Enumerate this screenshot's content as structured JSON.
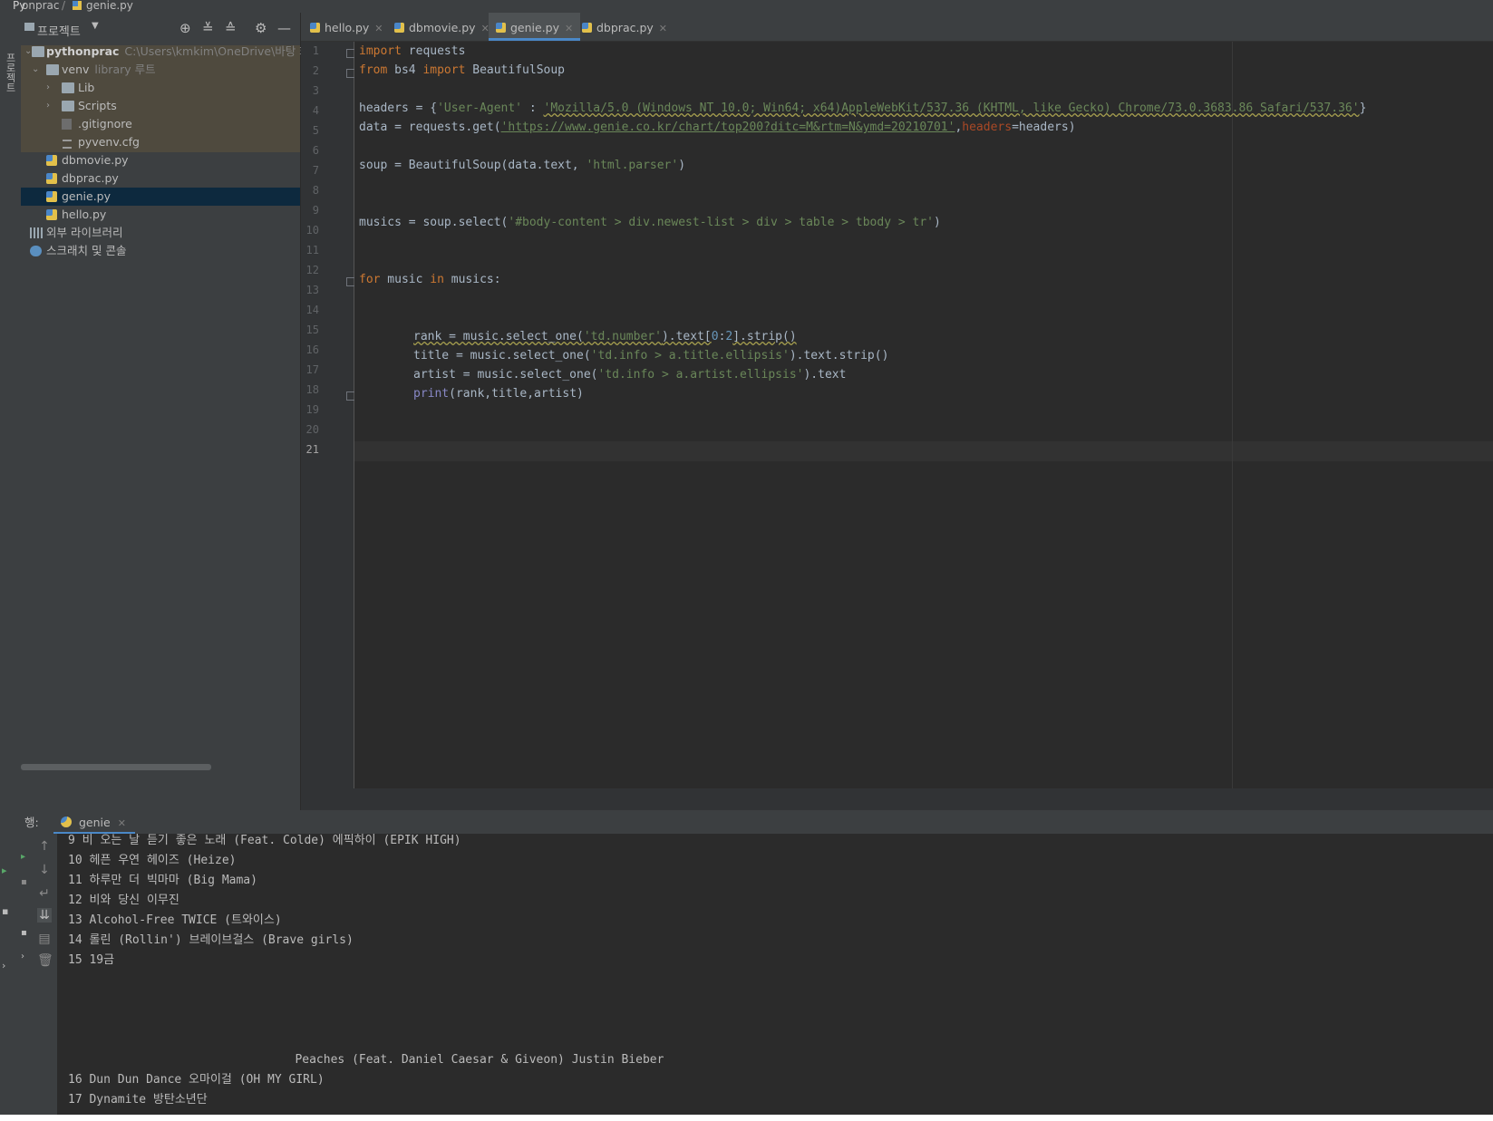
{
  "top_bar": {
    "project": "onprac",
    "separator": "/",
    "file": "genie.py",
    "left_icon": "Py"
  },
  "left_strip": {
    "vertical_tab": "프로젝트"
  },
  "project_panel": {
    "title": "프로젝트",
    "tools": [
      "crosshair-icon",
      "expand-all-icon",
      "collapse-all-icon",
      "gear-icon",
      "minimize-icon"
    ],
    "root": {
      "name": "pythonprac",
      "path": "C:\\Users\\kmkim\\OneDrive\\바탕 화면"
    },
    "venv": {
      "name": "venv",
      "hint": "library 루트"
    },
    "venv_children": [
      "Lib",
      "Scripts",
      ".gitignore",
      "pyvenv.cfg"
    ],
    "files": [
      "dbmovie.py",
      "dbprac.py",
      "genie.py",
      "hello.py"
    ],
    "external": "외부 라이브러리",
    "scratches": "스크래치 및 콘솔"
  },
  "editor": {
    "tabs": [
      {
        "label": "hello.py",
        "active": false
      },
      {
        "label": "dbmovie.py",
        "active": false
      },
      {
        "label": "genie.py",
        "active": true
      },
      {
        "label": "dbprac.py",
        "active": false
      }
    ],
    "line_numbers": [
      "1",
      "2",
      "3",
      "4",
      "5",
      "6",
      "7",
      "8",
      "9",
      "10",
      "11",
      "12",
      "13",
      "14",
      "15",
      "16",
      "17",
      "18",
      "19",
      "20",
      "21"
    ],
    "current_line": 21,
    "code": {
      "l1": "requests",
      "l2a": "bs4",
      "l2b": "BeautifulSoup",
      "l4_var": "headers = {",
      "l4_key": "'User-Agent'",
      "l4_sep": " : ",
      "l4_val": "'Mozilla/5.0 (Windows NT 10.0; Win64; x64)AppleWebKit/537.36 (KHTML, like Gecko) Chrome/73.0.3683.86 Safari/537.36'",
      "l4_end": "}",
      "l5_pre": "data = requests.get(",
      "l5_url": "'https://www.genie.co.kr/chart/top200?ditc=M&rtm=N&ymd=20210701'",
      "l5_comma": ",",
      "l5_param": "headers",
      "l5_end": "=headers)",
      "l7_pre": "soup = BeautifulSoup(data.text, ",
      "l7_str": "'html.parser'",
      "l7_end": ")",
      "l10_pre": "musics = soup.select(",
      "l10_str": "'#body-content > div.newest-list > div > table > tbody > tr'",
      "l10_end": ")",
      "l13_mid": " music ",
      "l13_end": " musics:",
      "l16_pre": "rank = music.select_one(",
      "l16_str": "'td.number'",
      "l16_mid": ").text[",
      "l16_n0": "0",
      "l16_colon": ":",
      "l16_n2": "2",
      "l16_end": "].strip()",
      "l17_pre": "title = music.select_one(",
      "l17_str": "'td.info > a.title.ellipsis'",
      "l17_end": ").text.strip()",
      "l18_pre": "artist = music.select_one(",
      "l18_str": "'td.info > a.artist.ellipsis'",
      "l18_end": ").text",
      "l19_fn": "print",
      "l19_args": "(rank,title,artist)",
      "kw_import": "import",
      "kw_from": "from",
      "kw_for": "for",
      "kw_in": "in"
    }
  },
  "run_panel": {
    "label": "행:",
    "tab": "genie",
    "tools": [
      "arrow-up-icon",
      "arrow-down-icon",
      "soft-wrap-icon",
      "scroll-to-end-icon",
      "print-icon",
      "trash-icon"
    ],
    "output": [
      "9 비 오는 날 듣기 좋은 노래 (Feat. Colde) 에픽하이 (EPIK HIGH)",
      "10 헤픈 우연 헤이즈 (Heize)",
      "11 하루만 더 빅마마 (Big Mama)",
      "12 비와 당신 이무진",
      "13 Alcohol-Free TWICE (트와이스)",
      "14 롤린 (Rollin') 브레이브걸스 (Brave girls)",
      "15 19금",
      "",
      "",
      "",
      "",
      "                                Peaches (Feat. Daniel Caesar & Giveon) Justin Bieber",
      "16 Dun Dun Dance 오마이걸 (OH MY GIRL)",
      "17 Dynamite 방탄소년단"
    ]
  },
  "colors": {
    "background": "#2b2b2b",
    "panel": "#3c3f41",
    "keyword": "#cc7832",
    "string": "#6a8759",
    "number": "#6897bb",
    "builtin": "#8888c6",
    "param": "#aa4926",
    "selection": "#0d293e",
    "accent": "#4a88c7"
  }
}
